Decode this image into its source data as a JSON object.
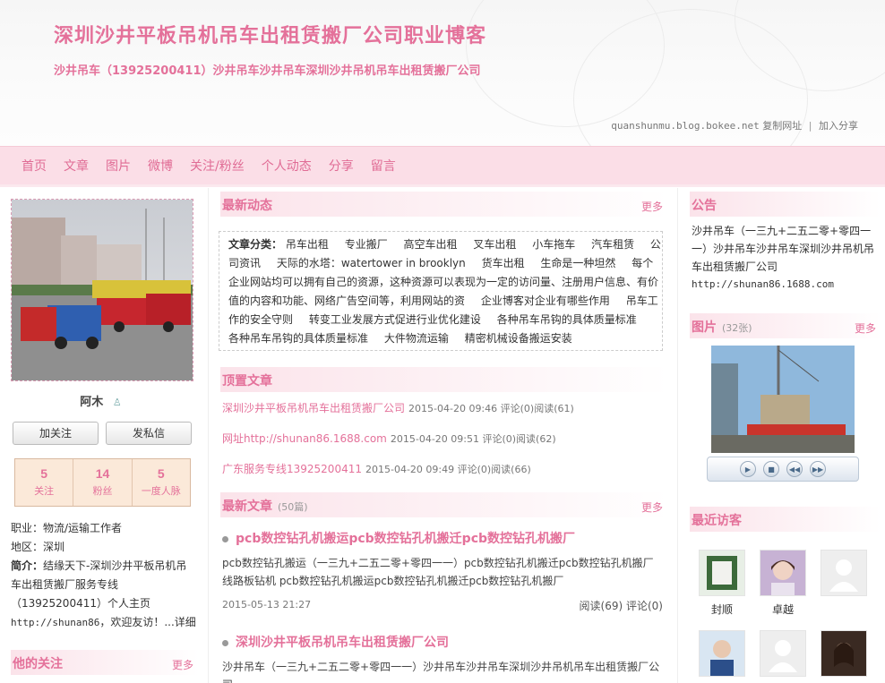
{
  "header": {
    "title": "深圳沙井平板吊机吊车出租赁搬厂公司职业博客",
    "subtitle": "沙井吊车（13925200411）沙井吊车沙井吊车深圳沙井吊机吊车出租赁搬厂公司",
    "url": "quanshunmu.blog.bokee.net",
    "copy_link": "复制网址",
    "share_link": "加入分享"
  },
  "nav": [
    "首页",
    "文章",
    "图片",
    "微博",
    "关注/粉丝",
    "个人动态",
    "分享",
    "留言"
  ],
  "profile": {
    "name": "阿木",
    "follow_btn": "加关注",
    "message_btn": "发私信",
    "stats": [
      {
        "num": "5",
        "label": "关注"
      },
      {
        "num": "14",
        "label": "粉丝"
      },
      {
        "num": "5",
        "label": "一度人脉"
      }
    ],
    "job": "职业：物流/运输工作者",
    "region": "地区：深圳",
    "intro_label": "简介：",
    "intro_text": "结缘天下-深圳沙井平板吊机吊车出租赁搬厂服务专线（13925200411）个人主页",
    "intro_url": "http://shunan86",
    "intro_tail": "，欢迎友访！...",
    "detail_link": "详细"
  },
  "following_section": {
    "title": "他的关注",
    "more": "更多"
  },
  "latest_activity": {
    "title": "最新动态",
    "more": "更多",
    "cat_label": "文章分类：",
    "categories": [
      "吊车出租",
      "专业搬厂",
      "高空车出租",
      "叉车出租",
      "小车拖车",
      "汽车租赁",
      "公司资讯",
      "天际的水塔：watertower in brooklyn",
      "货车出租",
      "生命是一种坦然",
      "每个企业网站均可以拥有自己的资源，这种资源可以表现为一定的访问量、注册用户信息、有价值的内容和功能、网络广告空间等，利用网站的资",
      "企业博客对企业有哪些作用",
      "吊车工作的安全守则",
      "转变工业发展方式促进行业优化建设",
      "各种吊车吊钩的具体质量标准",
      "各种吊车吊钩的具体质量标准",
      "大件物流运输",
      "精密机械设备搬运安装"
    ]
  },
  "pinned": {
    "title": "顶置文章",
    "items": [
      {
        "title": "深圳沙井平板吊机吊车出租赁搬厂公司",
        "meta": "2015-04-20 09:46 评论(0)阅读(61)"
      },
      {
        "title": "网址http://shunan86.1688.com",
        "meta": "2015-04-20 09:51 评论(0)阅读(62)"
      },
      {
        "title": "广东服务专线13925200411",
        "meta": "2015-04-20 09:49 评论(0)阅读(66)"
      }
    ]
  },
  "latest_articles": {
    "title": "最新文章",
    "count": "(50篇)",
    "more": "更多",
    "items": [
      {
        "title": "pcb数控钻孔机搬运pcb数控钻孔机搬迁pcb数控钻孔机搬厂",
        "body": "pcb数控钻孔搬运（一三九+二五二零+零四一一）pcb数控钻孔机搬迁pcb数控钻孔机搬厂线路板钻机 pcb数控钻孔机搬运pcb数控钻孔机搬迁pcb数控钻孔机搬厂",
        "date": "2015-05-13 21:27",
        "stat": "阅读(69) 评论(0)"
      },
      {
        "title": "深圳沙井平板吊机吊车出租赁搬厂公司",
        "body": "沙井吊车（一三九+二五二零+零四一一）沙井吊车沙井吊车深圳沙井吊机吊车出租赁搬厂公司",
        "date": "",
        "stat": ""
      }
    ]
  },
  "notice": {
    "title": "公告",
    "text": "沙井吊车（一三九+二五二零+零四一一）沙井吊车沙井吊车深圳沙井吊机吊车出租赁搬厂公司",
    "url": "http://shunan86.1688.com"
  },
  "photos": {
    "title": "图片",
    "count": "(32张)",
    "more": "更多"
  },
  "visitors": {
    "title": "最近访客",
    "items": [
      {
        "name": "封顺"
      },
      {
        "name": "卓越"
      },
      {
        "name": ""
      },
      {
        "name": ""
      },
      {
        "name": ""
      },
      {
        "name": ""
      }
    ]
  }
}
